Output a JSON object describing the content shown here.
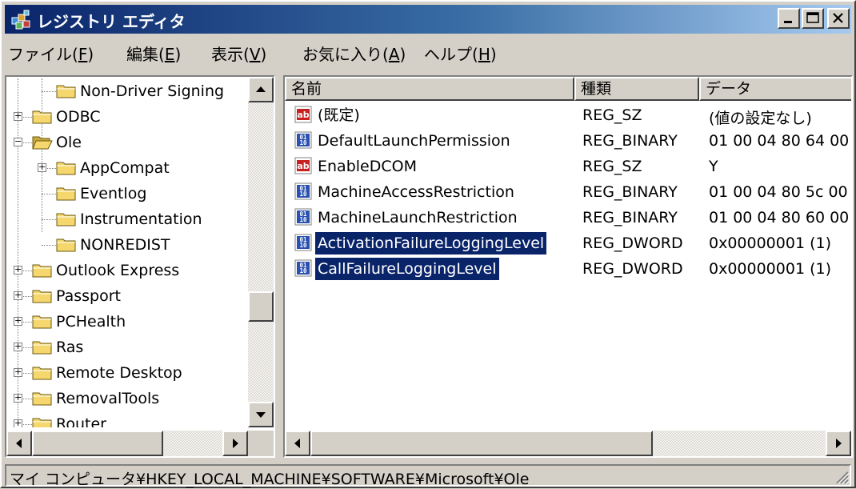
{
  "window": {
    "title": "レジストリ エディタ"
  },
  "menu": [
    {
      "text": "ファイル(",
      "key": "F",
      "end": ")"
    },
    {
      "text": "編集(",
      "key": "E",
      "end": ")"
    },
    {
      "text": "表示(",
      "key": "V",
      "end": ")"
    },
    {
      "text": "お気に入り(",
      "key": "A",
      "end": ")"
    },
    {
      "text": "ヘルプ(",
      "key": "H",
      "end": ")"
    }
  ],
  "tree": {
    "items": [
      {
        "label": "Non-Driver Signing",
        "level": 2,
        "expander": "none",
        "open": false
      },
      {
        "label": "ODBC",
        "level": 1,
        "expander": "plus",
        "open": false
      },
      {
        "label": "Ole",
        "level": 1,
        "expander": "minus",
        "open": true
      },
      {
        "label": "AppCompat",
        "level": 2,
        "expander": "plus",
        "open": false
      },
      {
        "label": "Eventlog",
        "level": 2,
        "expander": "none",
        "open": false
      },
      {
        "label": "Instrumentation",
        "level": 2,
        "expander": "none",
        "open": false
      },
      {
        "label": "NONREDIST",
        "level": 2,
        "expander": "none",
        "open": false
      },
      {
        "label": "Outlook Express",
        "level": 1,
        "expander": "plus",
        "open": false
      },
      {
        "label": "Passport",
        "level": 1,
        "expander": "plus",
        "open": false
      },
      {
        "label": "PCHealth",
        "level": 1,
        "expander": "plus",
        "open": false
      },
      {
        "label": "Ras",
        "level": 1,
        "expander": "plus",
        "open": false
      },
      {
        "label": "Remote Desktop",
        "level": 1,
        "expander": "plus",
        "open": false
      },
      {
        "label": "RemovalTools",
        "level": 1,
        "expander": "plus",
        "open": false
      },
      {
        "label": "Router",
        "level": 1,
        "expander": "plus",
        "open": false
      }
    ]
  },
  "list": {
    "columns": [
      "名前",
      "種類",
      "データ"
    ],
    "rows": [
      {
        "icon": "string-value-icon",
        "name": "(既定)",
        "type": "REG_SZ",
        "data": "(値の設定なし)",
        "selected": false
      },
      {
        "icon": "binary-value-icon",
        "name": "DefaultLaunchPermission",
        "type": "REG_BINARY",
        "data": "01 00 04 80 64 00",
        "selected": false
      },
      {
        "icon": "string-value-icon",
        "name": "EnableDCOM",
        "type": "REG_SZ",
        "data": "Y",
        "selected": false
      },
      {
        "icon": "binary-value-icon",
        "name": "MachineAccessRestriction",
        "type": "REG_BINARY",
        "data": "01 00 04 80 5c 00",
        "selected": false
      },
      {
        "icon": "binary-value-icon",
        "name": "MachineLaunchRestriction",
        "type": "REG_BINARY",
        "data": "01 00 04 80 60 00",
        "selected": false
      },
      {
        "icon": "binary-value-icon",
        "name": "ActivationFailureLoggingLevel",
        "type": "REG_DWORD",
        "data": "0x00000001 (1)",
        "selected": true
      },
      {
        "icon": "binary-value-icon",
        "name": "CallFailureLoggingLevel",
        "type": "REG_DWORD",
        "data": "0x00000001 (1)",
        "selected": true
      }
    ]
  },
  "status": {
    "path": "マイ コンピュータ¥HKEY_LOCAL_MACHINE¥SOFTWARE¥Microsoft¥Ole"
  },
  "colors": {
    "selection": "#0a246a",
    "folder": "#f5d76e",
    "face": "#d4d0c8"
  }
}
